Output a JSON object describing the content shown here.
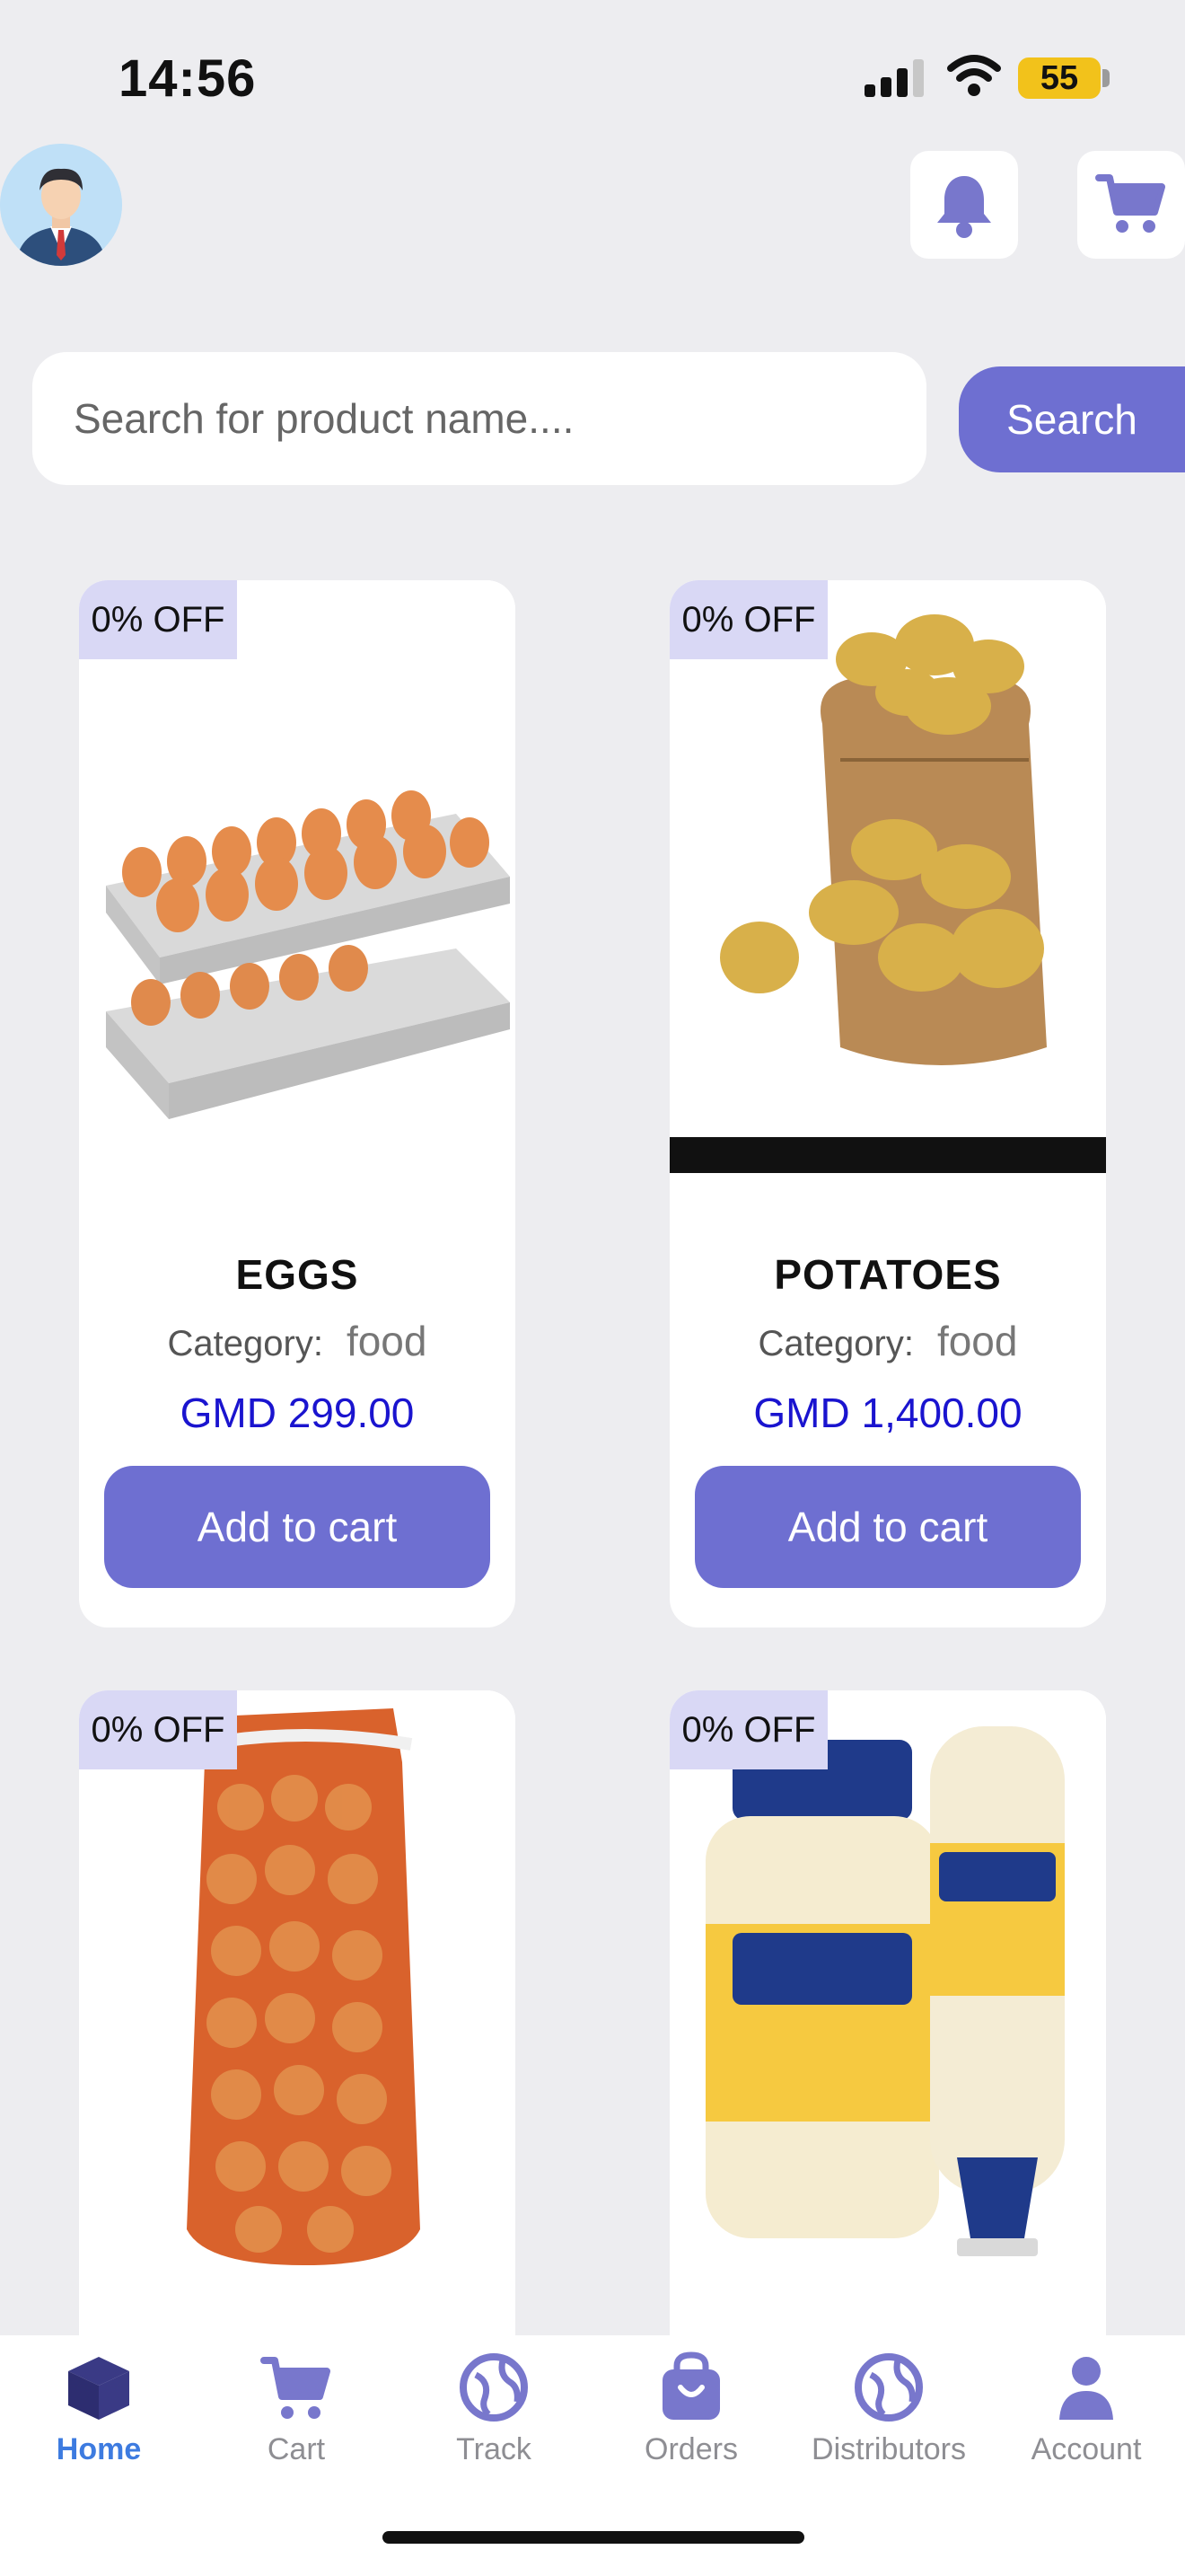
{
  "status_bar": {
    "time": "14:56",
    "battery": "55"
  },
  "header": {
    "avatar": "avatar",
    "notification_icon": "bell-icon",
    "cart_icon": "cart-icon"
  },
  "search": {
    "placeholder": "Search for product name....",
    "value": "",
    "button_label": "Search"
  },
  "products": [
    {
      "discount": "0% OFF",
      "name": "EGGS",
      "category_label": "Category:",
      "category": "food",
      "price": "GMD 299.00",
      "button_label": "Add to cart",
      "image": "egg trays"
    },
    {
      "discount": "0% OFF",
      "name": "POTATOES",
      "category_label": "Category:",
      "category": "food",
      "price": "GMD 1,400.00",
      "button_label": "Add to cart",
      "image": "potato sack"
    },
    {
      "discount": "0% OFF",
      "image": "onion mesh bag"
    },
    {
      "discount": "0% OFF",
      "image": "mayonnaise jars"
    }
  ],
  "bottom_nav": [
    {
      "label": "Home",
      "icon": "box-icon",
      "active": true
    },
    {
      "label": "Cart",
      "icon": "cart-icon",
      "active": false
    },
    {
      "label": "Track",
      "icon": "globe-icon",
      "active": false
    },
    {
      "label": "Orders",
      "icon": "bag-icon",
      "active": false
    },
    {
      "label": "Distributors",
      "icon": "globe-icon",
      "active": false
    },
    {
      "label": "Account",
      "icon": "person-icon",
      "active": false
    }
  ],
  "colors": {
    "accent": "#6e6fd1",
    "price": "#1a14cf",
    "nav_active": "#3d7be0",
    "badge_bg": "#d9d8f5",
    "background": "#ededf0"
  }
}
